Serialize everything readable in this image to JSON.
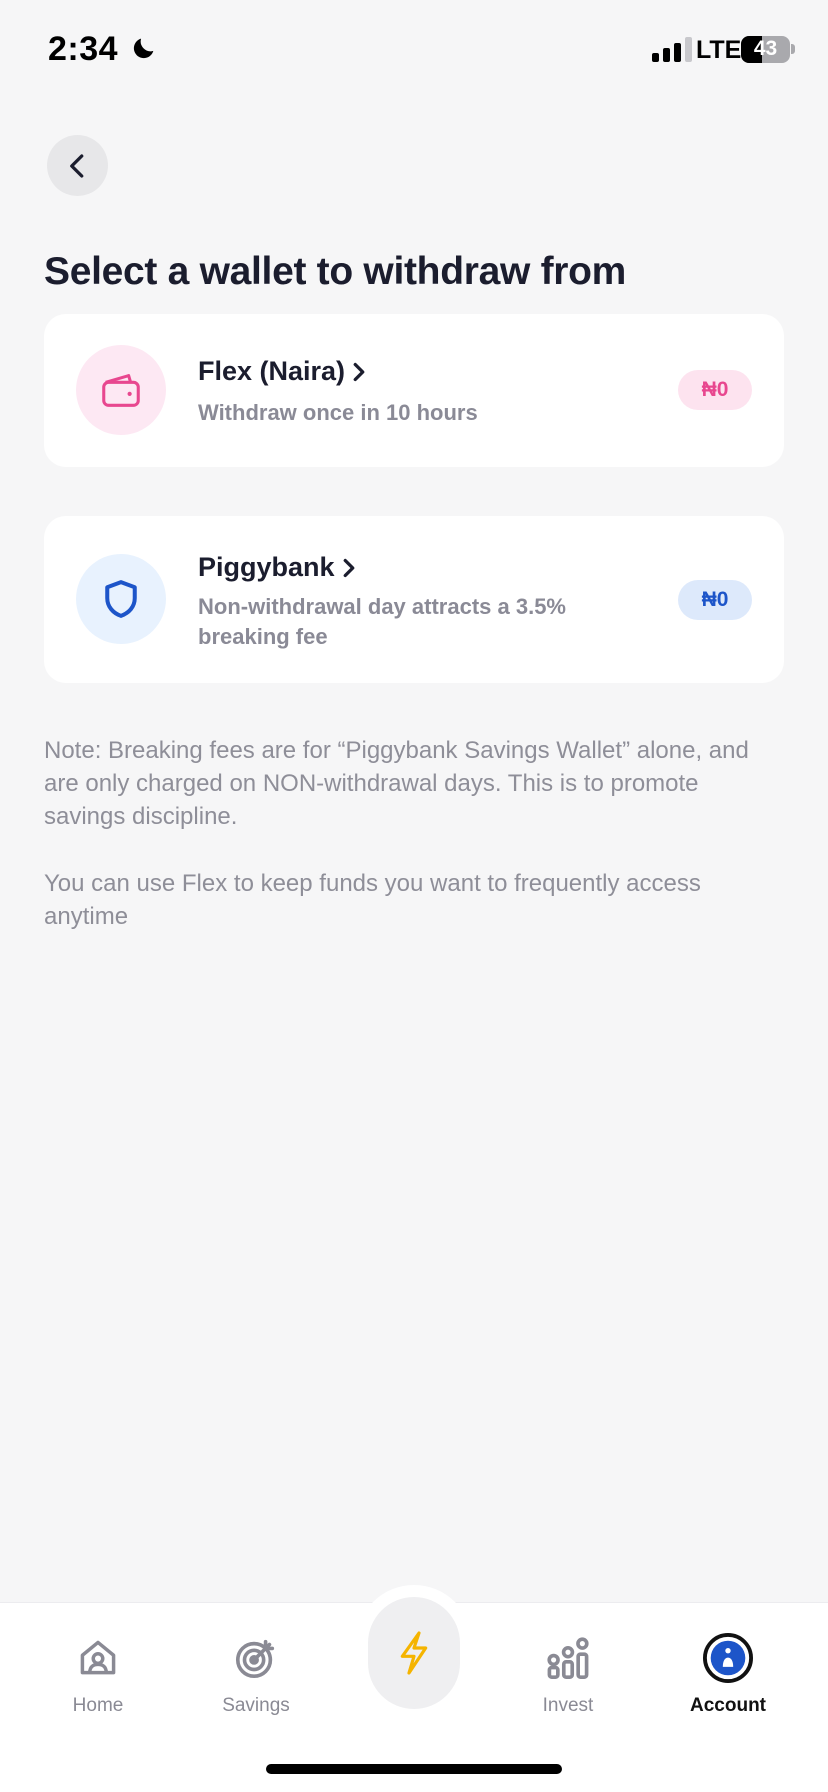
{
  "status_bar": {
    "time": "2:34",
    "network": "LTE",
    "battery": "43"
  },
  "page": {
    "title": "Select a wallet to withdraw from"
  },
  "wallets": [
    {
      "name": "Flex (Naira)",
      "chevron": "›",
      "description": "Withdraw once in 10 hours",
      "balance": "₦0",
      "icon": "wallet-icon",
      "accent": "#e8478f"
    },
    {
      "name": "Piggybank",
      "chevron": "›",
      "description": "Non-withdrawal day attracts a 3.5% breaking fee",
      "balance": "₦0",
      "icon": "shield-icon",
      "accent": "#1d55c9"
    }
  ],
  "notes": [
    "Note: Breaking fees are for “Piggybank Savings Wallet” alone, and are only charged on NON-withdrawal days. This is to promote savings discipline.",
    "You can use Flex to keep funds you want to frequently access anytime"
  ],
  "nav": {
    "items": [
      {
        "label": "Home",
        "icon": "home-icon"
      },
      {
        "label": "Savings",
        "icon": "target-icon"
      },
      {
        "label": "",
        "icon": "lightning-icon"
      },
      {
        "label": "Invest",
        "icon": "invest-chart-icon"
      },
      {
        "label": "Account",
        "icon": "account-icon",
        "active": true
      }
    ]
  },
  "colors": {
    "background": "#f6f6f7",
    "text_primary": "#1b1d2e",
    "lightning": "#f5b400",
    "account_blue": "#1d55c9"
  }
}
